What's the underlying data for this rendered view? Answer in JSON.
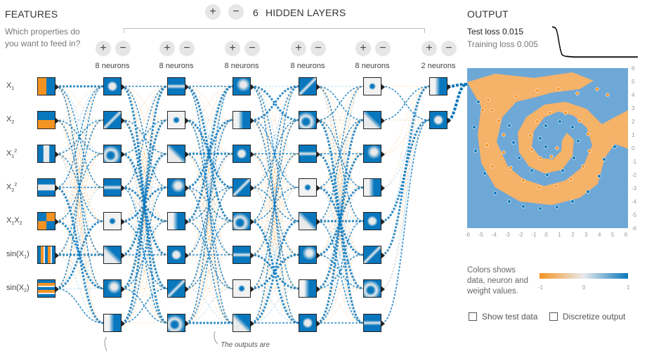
{
  "features": {
    "title": "FEATURES",
    "subtitle_line1": "Which properties do",
    "subtitle_line2": "you want to feed in?",
    "items": [
      {
        "base": "X",
        "sub": "1",
        "sup": ""
      },
      {
        "base": "X",
        "sub": "2",
        "sup": ""
      },
      {
        "base": "X",
        "sub": "1",
        "sup": "2"
      },
      {
        "base": "X",
        "sub": "2",
        "sup": "2"
      },
      {
        "base": "X",
        "sub": "1",
        "sup": "",
        "tail": "X",
        "tailsub": "2"
      },
      {
        "base": "sin(X",
        "sub": "1",
        "sup": "",
        "close": ")"
      },
      {
        "base": "sin(X",
        "sub": "2",
        "sup": "",
        "close": ")"
      }
    ]
  },
  "layers_control": {
    "count": "6",
    "label": "HIDDEN LAYERS",
    "plus": "+",
    "minus": "−"
  },
  "layers": [
    {
      "neurons_label": "8 neurons",
      "count": 8
    },
    {
      "neurons_label": "8 neurons",
      "count": 8
    },
    {
      "neurons_label": "8 neurons",
      "count": 8
    },
    {
      "neurons_label": "8 neurons",
      "count": 8
    },
    {
      "neurons_label": "8 neurons",
      "count": 8
    },
    {
      "neurons_label": "2 neurons",
      "count": 2
    }
  ],
  "output": {
    "title": "OUTPUT",
    "test_loss_label": "Test loss 0.015",
    "training_loss_label": "Training loss 0.005",
    "y_ticks": [
      "6",
      "5",
      "4",
      "3",
      "2",
      "1",
      "0",
      "-1",
      "-2",
      "-3",
      "-4",
      "-5",
      "-6"
    ],
    "x_ticks": [
      "-6",
      "-5",
      "-4",
      "-3",
      "-2",
      "-1",
      "0",
      "1",
      "2",
      "3",
      "4",
      "5",
      "6"
    ],
    "legend_line1": "Colors shows",
    "legend_line2": "data, neuron and",
    "legend_line3": "weight values.",
    "scale_min": "-1",
    "scale_mid": "0",
    "scale_max": "1",
    "show_test_data": "Show test data",
    "discretize_output": "Discretize output"
  },
  "annotation": "The outputs are",
  "colors": {
    "orange": "#f59322",
    "blue": "#0877bd",
    "light": "#e8eaeb"
  }
}
